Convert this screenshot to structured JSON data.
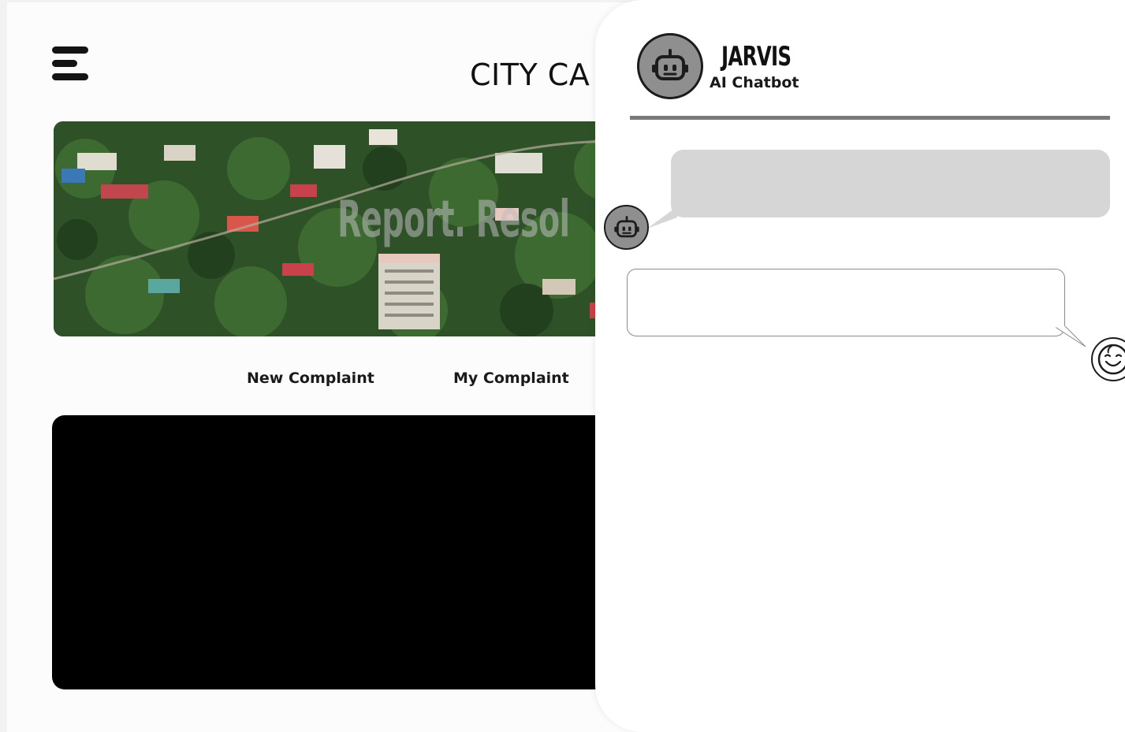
{
  "header": {
    "menu_icon": "hamburger-icon",
    "title": "CITY CA"
  },
  "hero": {
    "tagline": "Report. Resol"
  },
  "nav": {
    "new_complaint": "New Complaint",
    "my_complaint": "My Complaint"
  },
  "chatbot": {
    "name": "JARVIS",
    "subtitle": "AI Chatbot",
    "bot_icon": "robot-icon",
    "user_icon": "smiley-face-icon",
    "messages": [
      {
        "sender": "bot",
        "text": ""
      },
      {
        "sender": "user",
        "text": ""
      }
    ]
  },
  "colors": {
    "page_background": "#fcfcfc",
    "video_area": "#000000",
    "bot_bubble": "#d6d6d6",
    "divider": "#7a7a7a",
    "avatar_fill": "#8f8f8f"
  }
}
